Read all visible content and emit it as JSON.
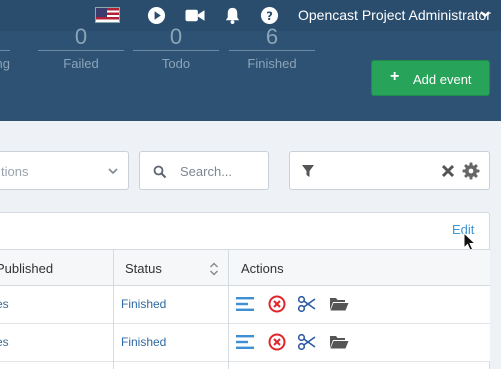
{
  "topbar": {
    "user_label": "Opencast Project Administrator",
    "icons": [
      "us-flag-icon",
      "play-icon",
      "video-camera-icon",
      "bell-icon",
      "help-icon",
      "chevron-down-icon"
    ]
  },
  "stats": [
    {
      "value": "0",
      "label": "ng"
    },
    {
      "value": "0",
      "label": "Failed"
    },
    {
      "value": "0",
      "label": "Todo"
    },
    {
      "value": "6",
      "label": "Finished"
    }
  ],
  "add_button": {
    "label": "Add event"
  },
  "filters": {
    "select_text": "tions",
    "search_placeholder": "Search..."
  },
  "table": {
    "edit_label": "Edit",
    "columns": [
      "Published",
      "Status",
      "Actions"
    ],
    "rows": [
      {
        "published": "es",
        "status": "Finished"
      },
      {
        "published": "es",
        "status": "Finished"
      }
    ]
  },
  "colors": {
    "nav_bg": "#2a4d6e",
    "stats_bg": "#2d5273",
    "add_button": "#27a35a",
    "link": "#3d97d5",
    "delete_red": "#e0262b"
  }
}
